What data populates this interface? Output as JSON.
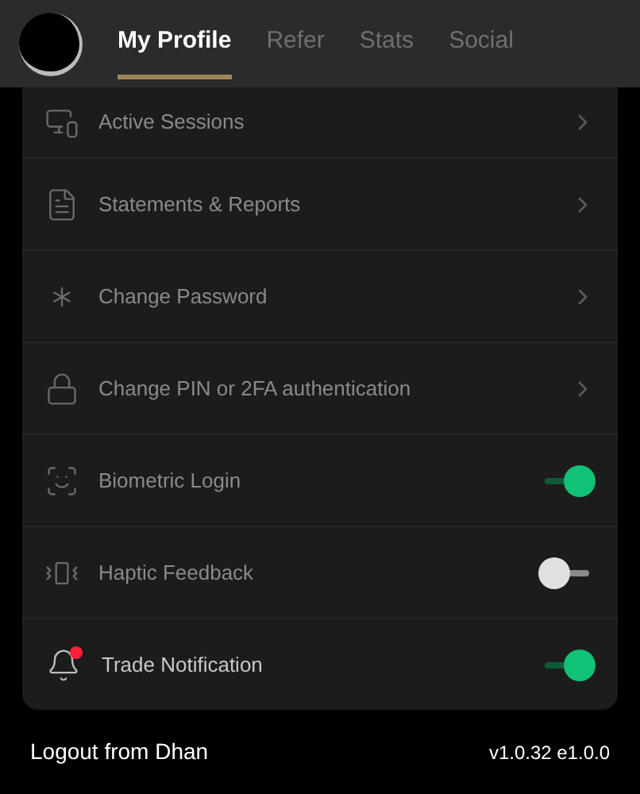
{
  "tabs": [
    {
      "label": "My Profile",
      "selected": true
    },
    {
      "label": "Refer",
      "selected": false
    },
    {
      "label": "Stats",
      "selected": false
    },
    {
      "label": "Social",
      "selected": false
    }
  ],
  "rows": [
    {
      "kind": "link",
      "label": "Active Sessions"
    },
    {
      "kind": "link",
      "label": "Statements & Reports"
    },
    {
      "kind": "link",
      "label": "Change Password"
    },
    {
      "kind": "link",
      "label": "Change PIN or 2FA authentication"
    },
    {
      "kind": "toggle",
      "label": "Biometric Login",
      "on": true
    },
    {
      "kind": "toggle",
      "label": "Haptic Feedback",
      "on": false
    },
    {
      "kind": "toggle",
      "label": "Trade Notification",
      "on": true
    }
  ],
  "footer": {
    "logout": "Logout from Dhan",
    "version": "v1.0.32 e1.0.0"
  }
}
